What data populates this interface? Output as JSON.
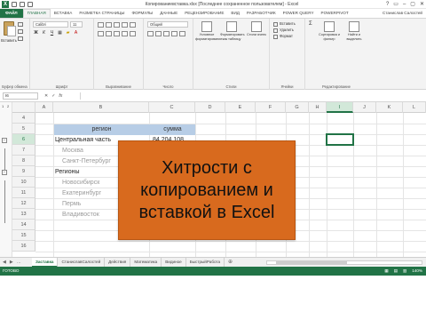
{
  "window": {
    "title": "Копированиевставка.xlsx [Последнее сохраненное пользователем] - Excel",
    "controls": [
      "?",
      "▭",
      "–",
      "▢",
      "✕"
    ]
  },
  "ribbon": {
    "tabs": [
      "ФАЙЛ",
      "ГЛАВНАЯ",
      "ВСТАВКА",
      "РАЗМЕТКА СТРАНИЦЫ",
      "ФОРМУЛЫ",
      "ДАННЫЕ",
      "РЕЦЕНЗИРОВАНИЕ",
      "ВИД",
      "РАЗРАБОТЧИК",
      "POWER QUERY",
      "POWERPIVOT"
    ],
    "active_tab": "ГЛАВНАЯ",
    "user": "Станислав Салостей",
    "paste_label": "Вставить",
    "font_name": "Calibri",
    "font_size": "11",
    "number_format": "Общий",
    "conditional_formatting": "Условное форматирование",
    "format_as_table": "Форматировать как таблицу",
    "cell_styles": "Стили ячеек",
    "cells_items": [
      "Вставить",
      "Удалить",
      "Формат"
    ],
    "sort_filter": "Сортировка и фильтр",
    "find_select": "Найти и выделить",
    "groups": [
      "Буфер обмена",
      "Шрифт",
      "Выравнивание",
      "Число",
      "Стили",
      "Ячейки",
      "Редактирование"
    ]
  },
  "formula_bar": {
    "name_box": "I6",
    "icons": [
      "✕",
      "✓",
      "fx"
    ],
    "value": ""
  },
  "grid": {
    "columns": [
      "A",
      "B",
      "C",
      "D",
      "E",
      "F",
      "G",
      "H",
      "I",
      "J",
      "K",
      "L"
    ],
    "selected_column": "I",
    "rows": [
      "4",
      "5",
      "6",
      "7",
      "8",
      "9",
      "10",
      "11",
      "12",
      "13",
      "14",
      "15",
      "16"
    ],
    "selected_row": "6",
    "outline_levels": [
      "1",
      "2"
    ],
    "selected_cell": "I6",
    "cells": {
      "region_header": "регион",
      "sum_header": "сумма",
      "central": "Центральная часть",
      "central_sum": "84 204 108",
      "moscow": "Москва",
      "spb": "Санкт-Петербург",
      "regions": "Регионы",
      "novosibirsk": "Новосибирск",
      "ekaterinburg": "Екатеринбург",
      "perm": "Пермь",
      "vladivostok": "Владивосток"
    }
  },
  "overlay": {
    "lines": [
      "Хитрости с",
      "копированием и",
      "вставкой в Excel"
    ]
  },
  "sheets": {
    "tabs": [
      "Заставка",
      "СтаниславСалостей",
      "Действия",
      "Математика",
      "Видиное",
      "БыстрыйРабота"
    ],
    "active": "Заставка",
    "add_label": "⊕",
    "nav": [
      "◀",
      "▶",
      "…"
    ]
  },
  "status": {
    "text": "ГОТОВО",
    "zoom": "140%",
    "view_icons": [
      "▦",
      "▤",
      "▥"
    ]
  },
  "colors": {
    "excel_green": "#217346",
    "overlay_orange": "#d86a1e",
    "header_band": "#b7cde6"
  }
}
